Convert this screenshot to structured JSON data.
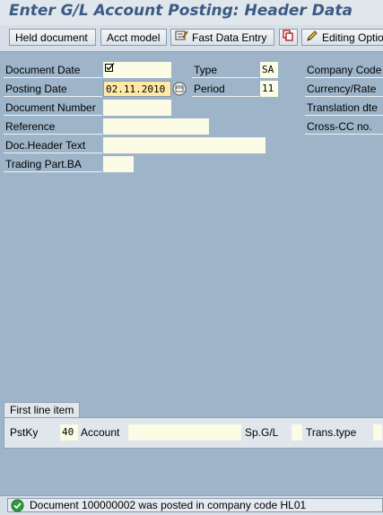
{
  "title": "Enter G/L Account Posting: Header Data",
  "toolbar": {
    "held_document": "Held document",
    "acct_model": "Acct model",
    "fast_data_entry": "Fast Data Entry",
    "editing_options": "Editing Optio"
  },
  "header": {
    "document_date_label": "Document Date",
    "document_date_value": "",
    "posting_date_label": "Posting Date",
    "posting_date_value": "02.11.2010",
    "document_number_label": "Document Number",
    "reference_label": "Reference",
    "doc_header_text_label": "Doc.Header Text",
    "trading_part_label": "Trading Part.BA",
    "type_label": "Type",
    "type_value": "SA",
    "period_label": "Period",
    "period_value": "11",
    "company_code_label": "Company Code",
    "currency_rate_label": "Currency/Rate",
    "translation_dte_label": "Translation dte",
    "cross_cc_label": "Cross-CC no."
  },
  "first_line_item": {
    "title": "First line item",
    "pstky_label": "PstKy",
    "pstky_value": "40",
    "account_label": "Account",
    "spgl_label": "Sp.G/L",
    "trans_type_label": "Trans.type"
  },
  "status": {
    "message": "Document 100000002 was posted in company code HL01"
  },
  "colors": {
    "background": "#9eb5c9",
    "title_text": "#3c5a82",
    "required_field": "#ffe9a6",
    "input_field": "#fbfbe6"
  }
}
